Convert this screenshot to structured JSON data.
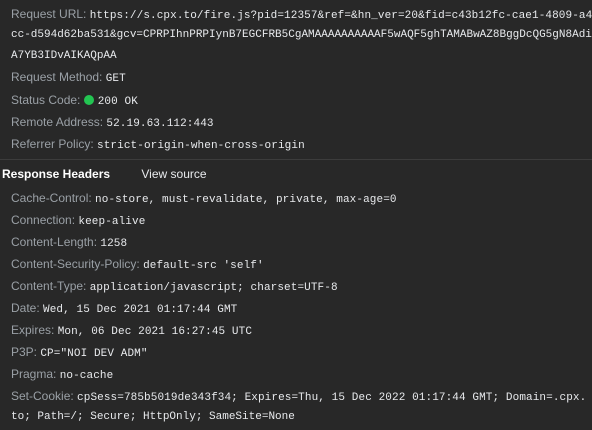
{
  "general": {
    "request_url_label": "Request URL:",
    "request_url_line1": "https://s.cpx.to/fire.js?pid=12357&ref=&hn_ver=20&fid=c43b12fc-cae1-4809-a4",
    "request_url_line2": "cc-d594d62ba531&gcv=CPRPIhnPRPIynB7EGCFRB5CgAMAAAAAAAAAAF5wAQF5ghTAMABwAZ8BggDcQG5gN8Adi",
    "request_url_line3": "A7YB3IDvAIKAQpAA",
    "request_method_label": "Request Method:",
    "request_method": "GET",
    "status_code_label": "Status Code:",
    "status_code": "200 OK",
    "status_color": "#23c552",
    "remote_address_label": "Remote Address:",
    "remote_address": "52.19.63.112:443",
    "referrer_policy_label": "Referrer Policy:",
    "referrer_policy": "strict-origin-when-cross-origin"
  },
  "response_headers": {
    "title": "Response Headers",
    "view_source": "View source",
    "items": [
      {
        "name": "Cache-Control:",
        "value": "no-store, must-revalidate, private, max-age=0"
      },
      {
        "name": "Connection:",
        "value": "keep-alive"
      },
      {
        "name": "Content-Length:",
        "value": "1258"
      },
      {
        "name": "Content-Security-Policy:",
        "value": "default-src 'self'"
      },
      {
        "name": "Content-Type:",
        "value": "application/javascript; charset=UTF-8"
      },
      {
        "name": "Date:",
        "value": "Wed, 15 Dec 2021 01:17:44 GMT"
      },
      {
        "name": "Expires:",
        "value": "Mon, 06 Dec 2021 16:27:45 UTC"
      },
      {
        "name": "P3P:",
        "value": "CP=\"NOI DEV ADM\""
      },
      {
        "name": "Pragma:",
        "value": "no-cache"
      },
      {
        "name": "Set-Cookie:",
        "value": "cpSess=785b5019de343f34; Expires=Thu, 15 Dec 2022 01:17:44 GMT; Domain=.cpx."
      }
    ],
    "set_cookie_line2": "to; Path=/; Secure; HttpOnly; SameSite=None"
  }
}
